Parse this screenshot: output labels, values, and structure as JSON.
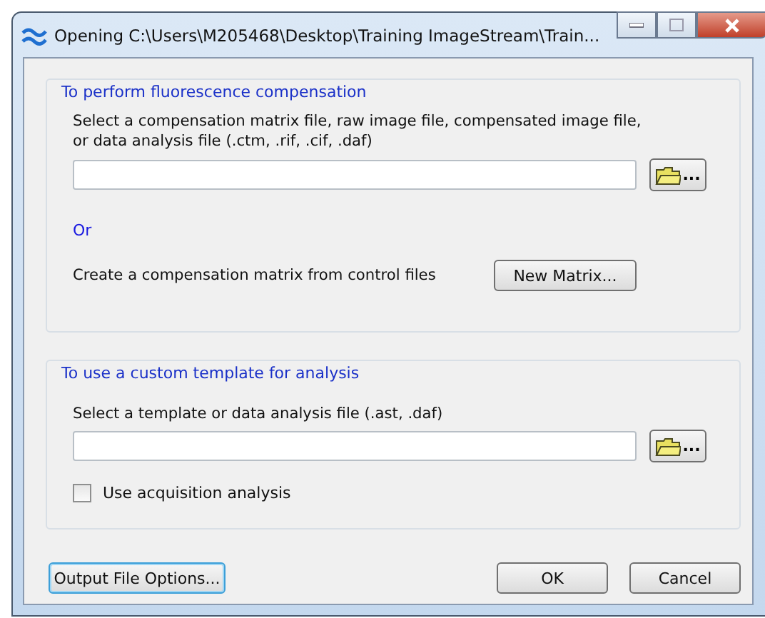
{
  "window": {
    "title": "Opening C:\\Users\\M205468\\Desktop\\Training ImageStream\\Train..."
  },
  "compensation": {
    "title": "To perform fluorescence compensation",
    "prompt": "Select a compensation matrix file, raw image file, compensated image file, or data analysis file (.ctm, .rif, .cif, .daf)",
    "browse_label": "...",
    "or": "Or",
    "create_label": "Create a compensation matrix from control files",
    "new_matrix": "New Matrix..."
  },
  "template": {
    "title": "To use a custom template for analysis",
    "prompt": "Select a template or data analysis file (.ast, .daf)",
    "browse_label": "...",
    "checkbox": {
      "label": "Use acquisition analysis",
      "checked": false
    }
  },
  "buttons": [
    {
      "label": "Output File Options...",
      "focused": true
    },
    {
      "label": "OK",
      "focused": false
    },
    {
      "label": "Cancel",
      "focused": false
    }
  ]
}
